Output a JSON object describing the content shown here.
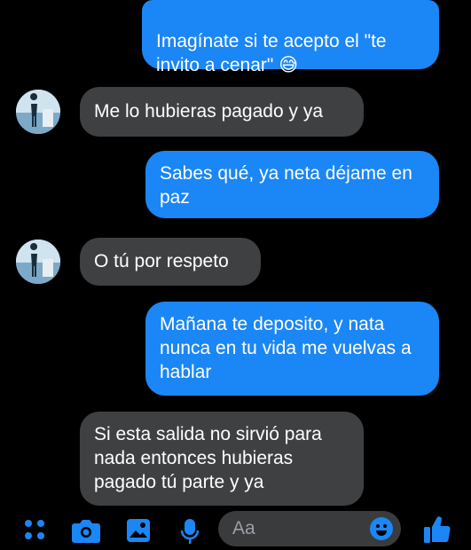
{
  "messages": [
    {
      "side": "out",
      "text": "Imagínate si te acepto el \"te invito a cenar\" 😅"
    },
    {
      "side": "in",
      "text": "Me lo hubieras pagado y ya"
    },
    {
      "side": "out",
      "text": "Sabes qué, ya neta déjame en paz"
    },
    {
      "side": "in",
      "text": "O tú por respeto"
    },
    {
      "side": "out",
      "text": "Mañana te deposito, y nata nunca en tu vida me vuelvas a hablar"
    },
    {
      "side": "in",
      "text": "Si esta salida no sirvió para nada entonces hubieras pagado tú parte y ya"
    }
  ],
  "composer": {
    "placeholder": "Aa",
    "icons": [
      "menu-dots-icon",
      "camera-icon",
      "gallery-icon",
      "microphone-icon",
      "emoji-icon",
      "like-icon"
    ]
  },
  "colors": {
    "outgoing": "#1b86f5",
    "incoming": "#3e4042",
    "background": "#000000"
  }
}
